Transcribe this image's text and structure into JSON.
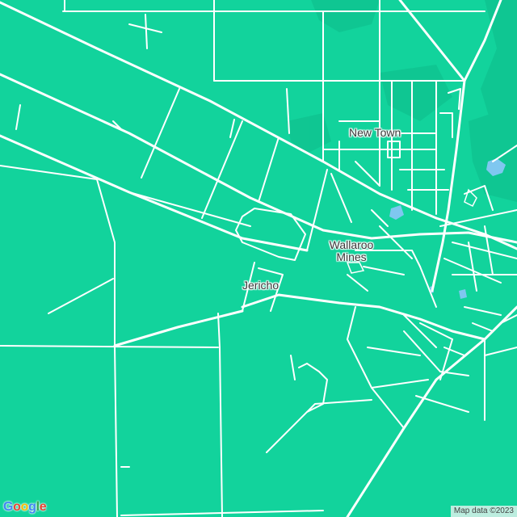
{
  "map": {
    "colors": {
      "land": "#12d39c",
      "land_dark": "#0fc18e",
      "road": "#ffffff",
      "water": "#7fc7f0"
    },
    "places": [
      {
        "id": "new-town",
        "label": "New Town"
      },
      {
        "id": "wallaroo-mines",
        "label_line1": "Wallaroo",
        "label_line2": "Mines"
      },
      {
        "id": "jericho",
        "label": "Jericho"
      }
    ]
  },
  "branding": {
    "logo_text": [
      "G",
      "o",
      "o",
      "g",
      "l",
      "e"
    ],
    "logo_icon": "google-logo"
  },
  "attribution": {
    "text": "Map data ©2023"
  }
}
